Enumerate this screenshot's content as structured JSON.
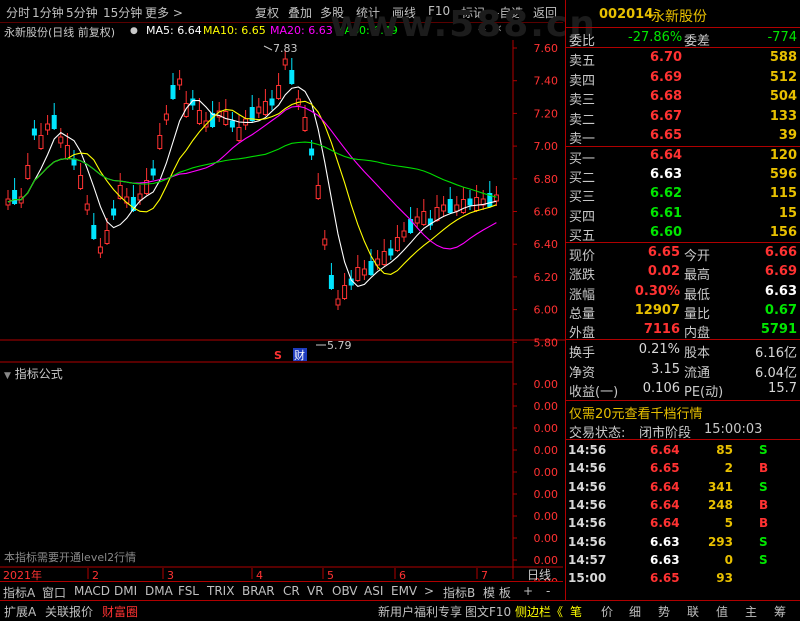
{
  "toolbar": {
    "left": [
      "分时",
      "1分钟",
      "5分钟",
      "15分钟",
      "更多 >"
    ],
    "right": [
      "复权",
      "叠加",
      "多股",
      "统计",
      "画线",
      "F10",
      "标记",
      "-自选",
      "返回"
    ]
  },
  "chart_title": {
    "stock": "永新股份(日线 前复权)",
    "ma5": "MA5: 6.64",
    "ma10": "MA10: 6.65",
    "ma20": "MA20: 6.63",
    "ma60": "MA60: 6.49",
    "watermark": "www.588.cn"
  },
  "price_axis": [
    "7.60",
    "7.40",
    "7.20",
    "7.00",
    "6.80",
    "6.60",
    "6.40",
    "6.20",
    "6.00",
    "5.80"
  ],
  "annotations": {
    "high": "7.83",
    "low": "5.79",
    "mark_s": "S",
    "mark_cai": "财"
  },
  "indicator": {
    "title": "指标公式",
    "axis": [
      "0.00",
      "0.00",
      "0.00",
      "0.00",
      "0.00",
      "0.00",
      "0.00",
      "0.00",
      "0.00",
      "0.00"
    ],
    "note": "本指标需要开通level2行情"
  },
  "date_axis": {
    "year": "2021年",
    "months": [
      "2",
      "3",
      "4",
      "5",
      "6",
      "7"
    ],
    "daily": "日线"
  },
  "tabs1": [
    "指标A",
    "窗口",
    "MACD",
    "DMI",
    "DMA",
    "FSL",
    "TRIX",
    "BRAR",
    "CR",
    "VR",
    "OBV",
    "ASI",
    "EMV",
    ">",
    "指标B",
    "模 板",
    "+",
    "-"
  ],
  "tabs2": [
    "扩展A",
    "关联报价",
    "财富圈",
    "新用户福利专享",
    "图文F10",
    "侧边栏《",
    "笔",
    "价",
    "细",
    "势",
    "联",
    "值",
    "主",
    "筹"
  ],
  "quote": {
    "code": "002014",
    "name": "永新股份",
    "webi_label": "委比",
    "webi": "-27.86%",
    "weicha_label": "委差",
    "weicha": "-774",
    "sell": [
      {
        "label": "卖五",
        "price": "6.70",
        "vol": "588"
      },
      {
        "label": "卖四",
        "price": "6.69",
        "vol": "512"
      },
      {
        "label": "卖三",
        "price": "6.68",
        "vol": "504"
      },
      {
        "label": "卖二",
        "price": "6.67",
        "vol": "133"
      },
      {
        "label": "卖一",
        "price": "6.65",
        "vol": "39"
      }
    ],
    "buy": [
      {
        "label": "买一",
        "price": "6.64",
        "vol": "120"
      },
      {
        "label": "买二",
        "price": "6.63",
        "vol": "596"
      },
      {
        "label": "买三",
        "price": "6.62",
        "vol": "115"
      },
      {
        "label": "买四",
        "price": "6.61",
        "vol": "15"
      },
      {
        "label": "买五",
        "price": "6.60",
        "vol": "156"
      }
    ],
    "stats": [
      {
        "l1": "现价",
        "v1": "6.65",
        "l2": "今开",
        "v2": "6.66"
      },
      {
        "l1": "涨跌",
        "v1": "0.02",
        "l2": "最高",
        "v2": "6.69"
      },
      {
        "l1": "涨幅",
        "v1": "0.30%",
        "l2": "最低",
        "v2": "6.63"
      },
      {
        "l1": "总量",
        "v1": "12907",
        "l2": "量比",
        "v2": "0.67"
      },
      {
        "l1": "外盘",
        "v1": "7116",
        "l2": "内盘",
        "v2": "5791"
      }
    ],
    "fund": [
      {
        "l1": "换手",
        "v1": "0.21%",
        "l2": "股本",
        "v2": "6.16亿"
      },
      {
        "l1": "净资",
        "v1": "3.15",
        "l2": "流通",
        "v2": "6.04亿"
      },
      {
        "l1": "收益(一)",
        "v1": "0.106",
        "l2": "PE(动)",
        "v2": "15.7"
      }
    ],
    "promo": "仅需20元查看千档行情",
    "status_label": "交易状态:",
    "status": "闭市阶段",
    "status_time": "15:00:03"
  },
  "ticks": [
    {
      "time": "14:56",
      "price": "6.64",
      "vol": "85",
      "side": "S"
    },
    {
      "time": "14:56",
      "price": "6.65",
      "vol": "2",
      "side": "B"
    },
    {
      "time": "14:56",
      "price": "6.64",
      "vol": "341",
      "side": "S"
    },
    {
      "time": "14:56",
      "price": "6.64",
      "vol": "248",
      "side": "B"
    },
    {
      "time": "14:56",
      "price": "6.64",
      "vol": "5",
      "side": "B"
    },
    {
      "time": "14:56",
      "price": "6.63",
      "vol": "293",
      "side": "S"
    },
    {
      "time": "14:57",
      "price": "6.63",
      "vol": "0",
      "side": "S"
    },
    {
      "time": "15:00",
      "price": "6.65",
      "vol": "93",
      "side": ""
    }
  ],
  "colors": {
    "up": "#ff3232",
    "down": "#00e600",
    "flat": "#ffffff",
    "border": "#b00000",
    "yellow": "#ffff00",
    "gold": "#e8c000"
  }
}
